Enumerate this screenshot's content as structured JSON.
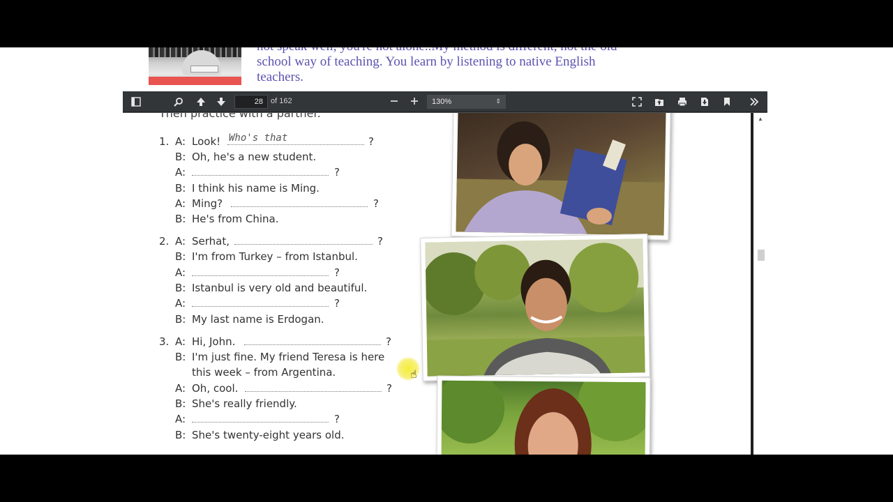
{
  "intro": {
    "line1": "not speak well, you're not alone..My method is different, not the old",
    "line2": "school way of teaching. You learn by listening to native English",
    "line3": "teachers."
  },
  "toolbar": {
    "page_current": "28",
    "page_total": "of 162",
    "zoom": "130%",
    "icons": [
      "sidebar-toggle-icon",
      "search-icon",
      "previous-page-icon",
      "next-page-icon",
      "zoom-out-icon",
      "zoom-in-icon",
      "presentation-mode-icon",
      "open-file-icon",
      "print-icon",
      "download-icon",
      "bookmark-icon",
      "tools-icon"
    ]
  },
  "document": {
    "cut_heading": "Then practice with a partner.",
    "exercises": [
      {
        "number": "1.",
        "lines": [
          {
            "speaker": "A:",
            "text": "Look!",
            "answer": "Who's that",
            "mark": "?"
          },
          {
            "speaker": "B:",
            "text": "Oh, he's a new student."
          },
          {
            "speaker": "A:",
            "text": "",
            "mark": "?"
          },
          {
            "speaker": "B:",
            "text": "I think his name is Ming."
          },
          {
            "speaker": "A:",
            "text": "Ming?",
            "mark": "?"
          },
          {
            "speaker": "B:",
            "text": "He's from China."
          }
        ]
      },
      {
        "number": "2.",
        "lines": [
          {
            "speaker": "A:",
            "text": "Serhat,",
            "mark": "?"
          },
          {
            "speaker": "B:",
            "text": "I'm from Turkey – from Istanbul."
          },
          {
            "speaker": "A:",
            "text": "",
            "mark": "?"
          },
          {
            "speaker": "B:",
            "text": "Istanbul is very old and beautiful."
          },
          {
            "speaker": "A:",
            "text": "",
            "mark": "?"
          },
          {
            "speaker": "B:",
            "text": "My last name is Erdogan."
          }
        ]
      },
      {
        "number": "3.",
        "lines": [
          {
            "speaker": "A:",
            "text": "Hi, John.",
            "mark": "?"
          },
          {
            "speaker": "B:",
            "text": "I'm just fine. My friend Teresa is here"
          },
          {
            "speaker": "",
            "text": "this week – from Argentina."
          },
          {
            "speaker": "A:",
            "text": "Oh, cool.",
            "mark": "?"
          },
          {
            "speaker": "B:",
            "text": "She's really friendly."
          },
          {
            "speaker": "A:",
            "text": "",
            "mark": "?"
          },
          {
            "speaker": "B:",
            "text": "She's twenty-eight years old."
          }
        ]
      }
    ]
  },
  "colors": {
    "intro_text": "#5b52b0",
    "toolbar_bg": "#323639",
    "thumb_band": "#e8544f"
  }
}
